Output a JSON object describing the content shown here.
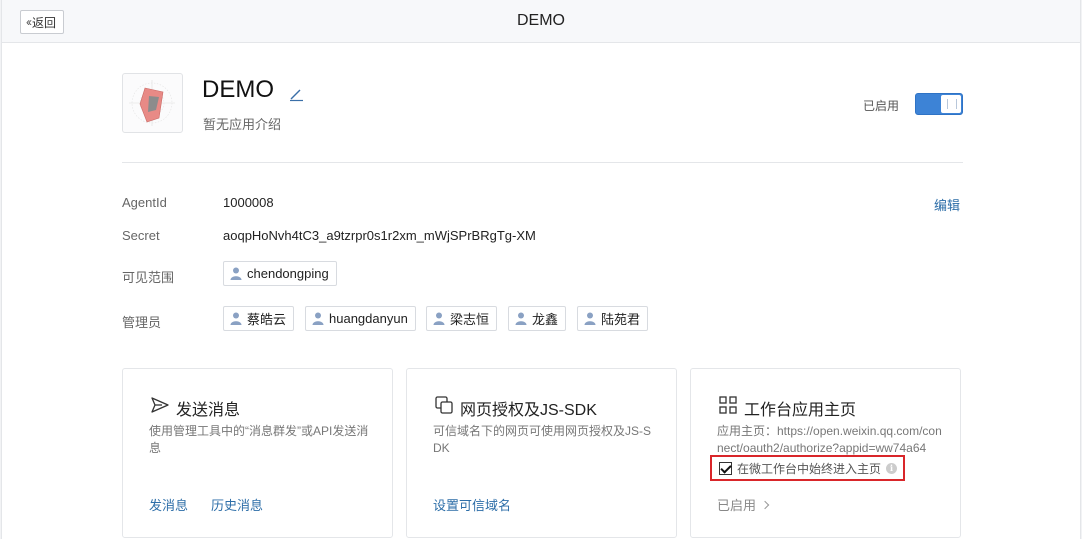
{
  "topbar": {
    "back_label": "返回",
    "title": "DEMO"
  },
  "app": {
    "name": "DEMO",
    "description": "暂无应用介绍",
    "status_label": "已启用",
    "enabled": true
  },
  "info": {
    "agentid_label": "AgentId",
    "agentid_value": "1000008",
    "secret_label": "Secret",
    "secret_value": "aoqpHoNvh4tC3_a9tzrpr0s1r2xm_mWjSPrBRgTg-XM",
    "edit_label": "编辑",
    "visible_label": "可见范围",
    "visible_users": [
      "chendongping"
    ],
    "admin_label": "管理员",
    "admins": [
      "蔡皓云",
      "huangdanyun",
      "梁志恒",
      "龙鑫",
      "陆苑君"
    ]
  },
  "cards": {
    "send": {
      "title": "发送消息",
      "desc": "使用管理工具中的“消息群发”或API发送消息",
      "link1": "发消息",
      "link2": "历史消息"
    },
    "web": {
      "title": "网页授权及JS-SDK",
      "desc": "可信域名下的网页可使用网页授权及JS-SDK",
      "link": "设置可信域名"
    },
    "home": {
      "title": "工作台应用主页",
      "desc": "应用主页：https://open.weixin.qq.com/connect/oauth2/authorize?appid=ww74a64",
      "checkbox_label": "在微工作台中始终进入主页",
      "status": "已启用"
    }
  },
  "colors": {
    "accent": "#3d83d6",
    "link": "#2d6ea8",
    "highlight": "#d9262a"
  }
}
